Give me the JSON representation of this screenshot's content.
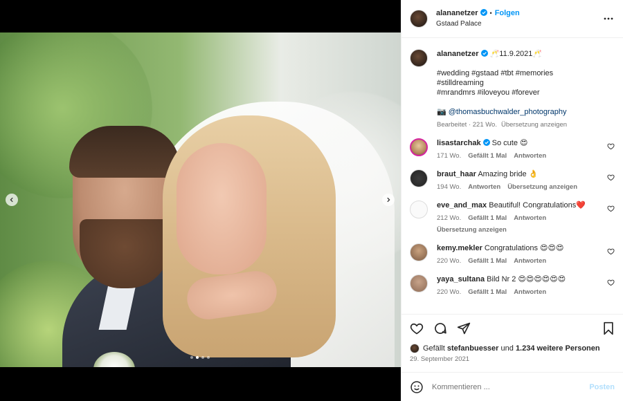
{
  "header": {
    "username": "alananetzer",
    "follow_label": "Folgen",
    "separator": "•",
    "location": "Gstaad Palace"
  },
  "caption": {
    "username": "alananetzer",
    "text_first": "🥂11.9.2021🥂",
    "hashtags_line1": "#wedding #gstaad #tbt #memories #stilldreaming",
    "hashtags_line2": "#mrandmrs #iloveyou #forever",
    "camera_emoji": "📷",
    "photographer": "@thomasbuchwalder_photography",
    "meta_edited": "Bearbeitet · 221 Wo.",
    "meta_translate": "Übersetzung anzeigen"
  },
  "comments": [
    {
      "username": "lisastarchak",
      "verified": true,
      "text": "So cute 😍",
      "age": "171 Wo.",
      "likes": "Gefällt 1 Mal",
      "reply": "Antworten",
      "translate": ""
    },
    {
      "username": "braut_haar",
      "verified": false,
      "text": "Amazing bride 👌",
      "age": "194 Wo.",
      "likes": "",
      "reply": "Antworten",
      "translate": "Übersetzung anzeigen"
    },
    {
      "username": "eve_and_max",
      "verified": false,
      "text": "Beautiful! Congratulations❤️",
      "age": "212 Wo.",
      "likes": "Gefällt 1 Mal",
      "reply": "Antworten",
      "translate": "Übersetzung anzeigen"
    },
    {
      "username": "kemy.mekler",
      "verified": false,
      "text": "Congratulations 😍😍😍",
      "age": "220 Wo.",
      "likes": "Gefällt 1 Mal",
      "reply": "Antworten",
      "translate": ""
    },
    {
      "username": "yaya_sultana",
      "verified": false,
      "text": "Bild Nr 2 😍😍😍😍😍😍",
      "age": "220 Wo.",
      "likes": "Gefällt 1 Mal",
      "reply": "Antworten",
      "translate": ""
    }
  ],
  "likes": {
    "prefix": "Gefällt",
    "liker": "stefanbuesser",
    "middle": "und",
    "others": "1.234 weitere Personen"
  },
  "date": "29. September 2021",
  "composer": {
    "placeholder": "Kommentieren ...",
    "post_label": "Posten"
  },
  "carousel": {
    "slide_count": 4,
    "active_index": 1
  },
  "colors": {
    "accent": "#0095f6",
    "hashtag": "#00376b",
    "muted": "#737373",
    "post_disabled": "#b2dffc"
  }
}
